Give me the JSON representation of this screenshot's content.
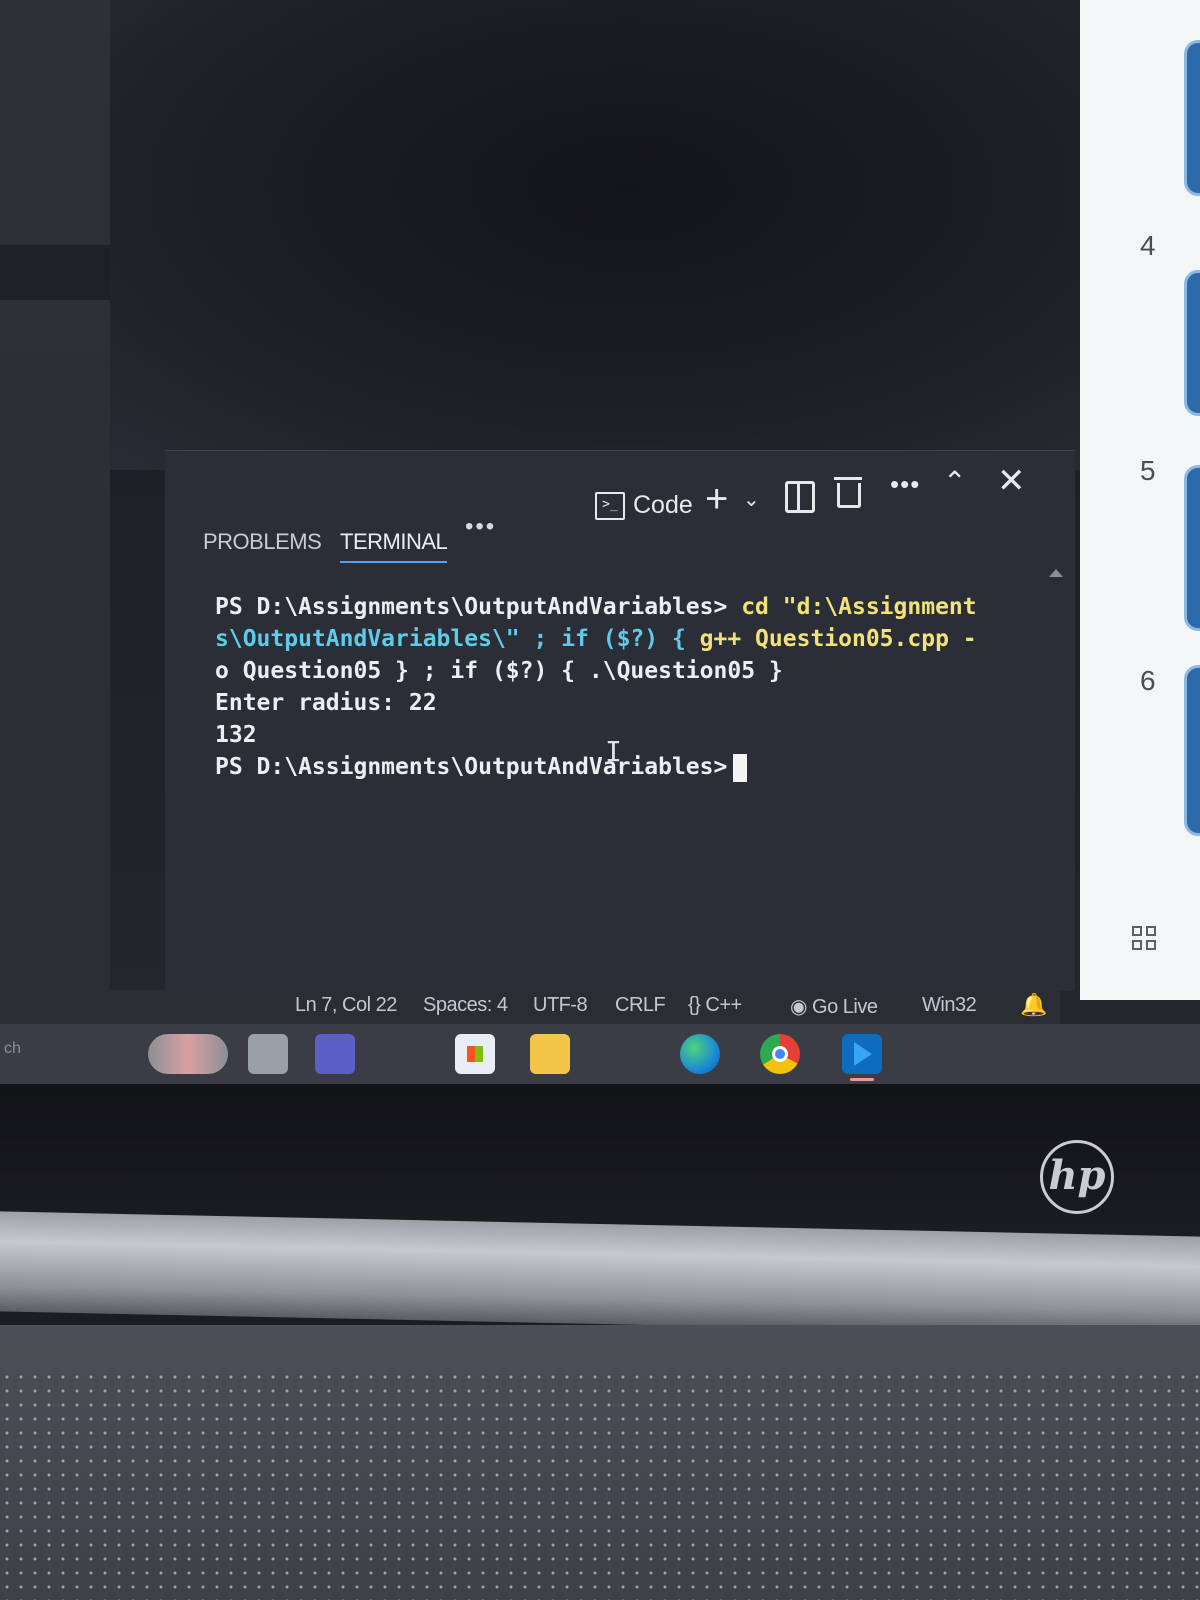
{
  "panel": {
    "tabs": [
      {
        "label": "PROBLEMS"
      },
      {
        "label": "TERMINAL"
      }
    ],
    "more_label": "•••",
    "terminal_profile_label": "Code",
    "actions_more": "•••"
  },
  "terminal": {
    "lines": [
      {
        "prompt": "PS D:\\Assignments\\OutputAndVariables> ",
        "cmd": "cd \"d:\\Assignment"
      },
      {
        "cont": "s\\OutputAndVariables\\\" ",
        "rest": "; if ($?) { ",
        "gpp": "g++ Question05.cpp -"
      },
      {
        "cont2": "o Question05 } ; if ($?) { .\\Question05 }"
      },
      {
        "text": "Enter radius: 22"
      },
      {
        "text": "132"
      },
      {
        "prompt": "PS D:\\Assignments\\OutputAndVariables>"
      }
    ]
  },
  "statusbar": {
    "position": "Ln 7, Col 22",
    "spaces": "Spaces: 4",
    "encoding": "UTF-8",
    "eol": "CRLF",
    "language": "{} C++",
    "golive": "Go Live",
    "platform": "Win32"
  },
  "taskbar": {
    "search_text": "ch"
  },
  "rightpane": {
    "numbers": [
      "4",
      "5",
      "6"
    ]
  },
  "colors": {
    "accent": "#4aa3ff",
    "terminal_bg": "#2b2e36",
    "cmd_yellow": "#f1e27a",
    "cmd_cyan": "#5ecbe8"
  }
}
